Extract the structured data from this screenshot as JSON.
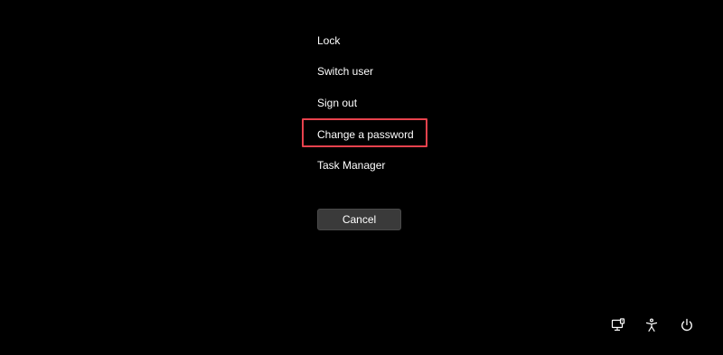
{
  "menu": {
    "items": [
      {
        "label": "Lock"
      },
      {
        "label": "Switch user"
      },
      {
        "label": "Sign out"
      },
      {
        "label": "Change a password"
      },
      {
        "label": "Task Manager"
      }
    ]
  },
  "cancel_button": {
    "label": "Cancel"
  },
  "tray": {
    "icons": [
      "network-icon",
      "accessibility-icon",
      "power-icon"
    ]
  },
  "colors": {
    "background": "#000000",
    "text": "#ffffff",
    "button_bg": "#3a3a3a",
    "highlight": "#e8424d"
  }
}
